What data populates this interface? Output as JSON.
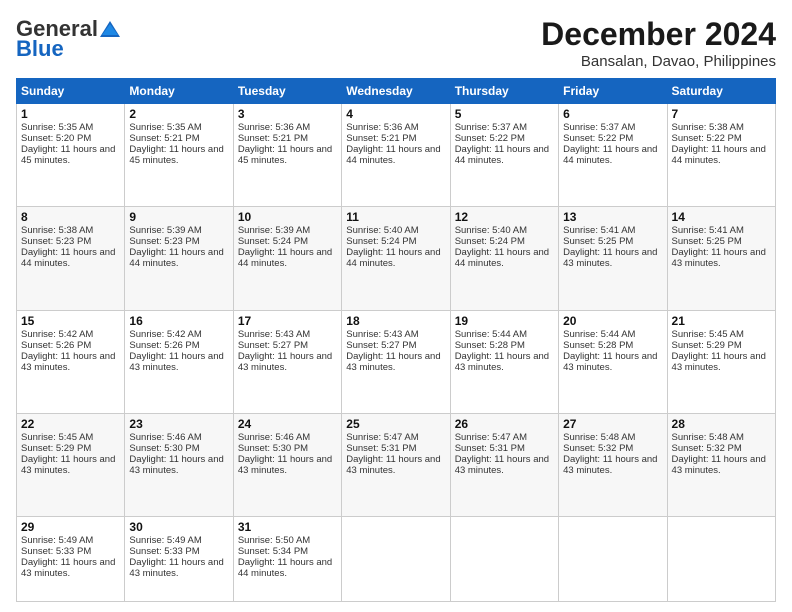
{
  "header": {
    "logo_general": "General",
    "logo_blue": "Blue",
    "month": "December 2024",
    "location": "Bansalan, Davao, Philippines"
  },
  "days_of_week": [
    "Sunday",
    "Monday",
    "Tuesday",
    "Wednesday",
    "Thursday",
    "Friday",
    "Saturday"
  ],
  "weeks": [
    [
      {
        "day": 1,
        "sunrise": "5:35 AM",
        "sunset": "5:20 PM",
        "daylight": "11 hours and 45 minutes."
      },
      {
        "day": 2,
        "sunrise": "5:35 AM",
        "sunset": "5:21 PM",
        "daylight": "11 hours and 45 minutes."
      },
      {
        "day": 3,
        "sunrise": "5:36 AM",
        "sunset": "5:21 PM",
        "daylight": "11 hours and 45 minutes."
      },
      {
        "day": 4,
        "sunrise": "5:36 AM",
        "sunset": "5:21 PM",
        "daylight": "11 hours and 44 minutes."
      },
      {
        "day": 5,
        "sunrise": "5:37 AM",
        "sunset": "5:22 PM",
        "daylight": "11 hours and 44 minutes."
      },
      {
        "day": 6,
        "sunrise": "5:37 AM",
        "sunset": "5:22 PM",
        "daylight": "11 hours and 44 minutes."
      },
      {
        "day": 7,
        "sunrise": "5:38 AM",
        "sunset": "5:22 PM",
        "daylight": "11 hours and 44 minutes."
      }
    ],
    [
      {
        "day": 8,
        "sunrise": "5:38 AM",
        "sunset": "5:23 PM",
        "daylight": "11 hours and 44 minutes."
      },
      {
        "day": 9,
        "sunrise": "5:39 AM",
        "sunset": "5:23 PM",
        "daylight": "11 hours and 44 minutes."
      },
      {
        "day": 10,
        "sunrise": "5:39 AM",
        "sunset": "5:24 PM",
        "daylight": "11 hours and 44 minutes."
      },
      {
        "day": 11,
        "sunrise": "5:40 AM",
        "sunset": "5:24 PM",
        "daylight": "11 hours and 44 minutes."
      },
      {
        "day": 12,
        "sunrise": "5:40 AM",
        "sunset": "5:24 PM",
        "daylight": "11 hours and 44 minutes."
      },
      {
        "day": 13,
        "sunrise": "5:41 AM",
        "sunset": "5:25 PM",
        "daylight": "11 hours and 43 minutes."
      },
      {
        "day": 14,
        "sunrise": "5:41 AM",
        "sunset": "5:25 PM",
        "daylight": "11 hours and 43 minutes."
      }
    ],
    [
      {
        "day": 15,
        "sunrise": "5:42 AM",
        "sunset": "5:26 PM",
        "daylight": "11 hours and 43 minutes."
      },
      {
        "day": 16,
        "sunrise": "5:42 AM",
        "sunset": "5:26 PM",
        "daylight": "11 hours and 43 minutes."
      },
      {
        "day": 17,
        "sunrise": "5:43 AM",
        "sunset": "5:27 PM",
        "daylight": "11 hours and 43 minutes."
      },
      {
        "day": 18,
        "sunrise": "5:43 AM",
        "sunset": "5:27 PM",
        "daylight": "11 hours and 43 minutes."
      },
      {
        "day": 19,
        "sunrise": "5:44 AM",
        "sunset": "5:28 PM",
        "daylight": "11 hours and 43 minutes."
      },
      {
        "day": 20,
        "sunrise": "5:44 AM",
        "sunset": "5:28 PM",
        "daylight": "11 hours and 43 minutes."
      },
      {
        "day": 21,
        "sunrise": "5:45 AM",
        "sunset": "5:29 PM",
        "daylight": "11 hours and 43 minutes."
      }
    ],
    [
      {
        "day": 22,
        "sunrise": "5:45 AM",
        "sunset": "5:29 PM",
        "daylight": "11 hours and 43 minutes."
      },
      {
        "day": 23,
        "sunrise": "5:46 AM",
        "sunset": "5:30 PM",
        "daylight": "11 hours and 43 minutes."
      },
      {
        "day": 24,
        "sunrise": "5:46 AM",
        "sunset": "5:30 PM",
        "daylight": "11 hours and 43 minutes."
      },
      {
        "day": 25,
        "sunrise": "5:47 AM",
        "sunset": "5:31 PM",
        "daylight": "11 hours and 43 minutes."
      },
      {
        "day": 26,
        "sunrise": "5:47 AM",
        "sunset": "5:31 PM",
        "daylight": "11 hours and 43 minutes."
      },
      {
        "day": 27,
        "sunrise": "5:48 AM",
        "sunset": "5:32 PM",
        "daylight": "11 hours and 43 minutes."
      },
      {
        "day": 28,
        "sunrise": "5:48 AM",
        "sunset": "5:32 PM",
        "daylight": "11 hours and 43 minutes."
      }
    ],
    [
      {
        "day": 29,
        "sunrise": "5:49 AM",
        "sunset": "5:33 PM",
        "daylight": "11 hours and 43 minutes."
      },
      {
        "day": 30,
        "sunrise": "5:49 AM",
        "sunset": "5:33 PM",
        "daylight": "11 hours and 43 minutes."
      },
      {
        "day": 31,
        "sunrise": "5:50 AM",
        "sunset": "5:34 PM",
        "daylight": "11 hours and 44 minutes."
      },
      null,
      null,
      null,
      null
    ]
  ]
}
